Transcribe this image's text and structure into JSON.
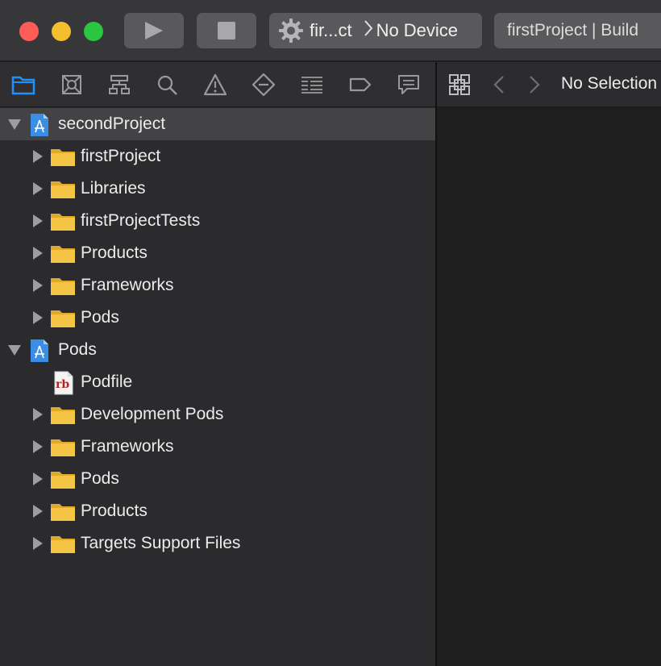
{
  "toolbar": {
    "scheme_name": "fir...ct",
    "destination": "No Device",
    "activity": "firstProject | Build"
  },
  "navigator_tabs": [
    {
      "icon": "folder-icon"
    },
    {
      "icon": "source-control-icon"
    },
    {
      "icon": "symbol-hierarchy-icon"
    },
    {
      "icon": "search-icon"
    },
    {
      "icon": "warning-icon"
    },
    {
      "icon": "test-diamond-icon"
    },
    {
      "icon": "debug-list-icon"
    },
    {
      "icon": "breakpoint-icon"
    },
    {
      "icon": "report-icon"
    }
  ],
  "tree": [
    {
      "label": "secondProject",
      "kind": "project",
      "depth": 0,
      "expanded": true,
      "selected": true
    },
    {
      "label": "firstProject",
      "kind": "folder",
      "depth": 1
    },
    {
      "label": "Libraries",
      "kind": "folder",
      "depth": 1
    },
    {
      "label": "firstProjectTests",
      "kind": "folder",
      "depth": 1
    },
    {
      "label": "Products",
      "kind": "folder",
      "depth": 1
    },
    {
      "label": "Frameworks",
      "kind": "folder",
      "depth": 1
    },
    {
      "label": "Pods",
      "kind": "folder",
      "depth": 1
    },
    {
      "label": "Pods",
      "kind": "project",
      "depth": 0,
      "expanded": true
    },
    {
      "label": "Podfile",
      "kind": "ruby-file",
      "depth": 1,
      "file_badge": "rb"
    },
    {
      "label": "Development Pods",
      "kind": "folder",
      "depth": 1
    },
    {
      "label": "Frameworks",
      "kind": "folder",
      "depth": 1
    },
    {
      "label": "Pods",
      "kind": "folder",
      "depth": 1
    },
    {
      "label": "Products",
      "kind": "folder",
      "depth": 1
    },
    {
      "label": "Targets Support Files",
      "kind": "folder",
      "depth": 1
    }
  ],
  "editor": {
    "jumpbar_text": "No Selection"
  },
  "colors": {
    "accent": "#1e90ff",
    "folder": "#f6c445",
    "close": "#fd5c57",
    "minimize": "#f3bf2e",
    "zoom": "#29c63f"
  }
}
